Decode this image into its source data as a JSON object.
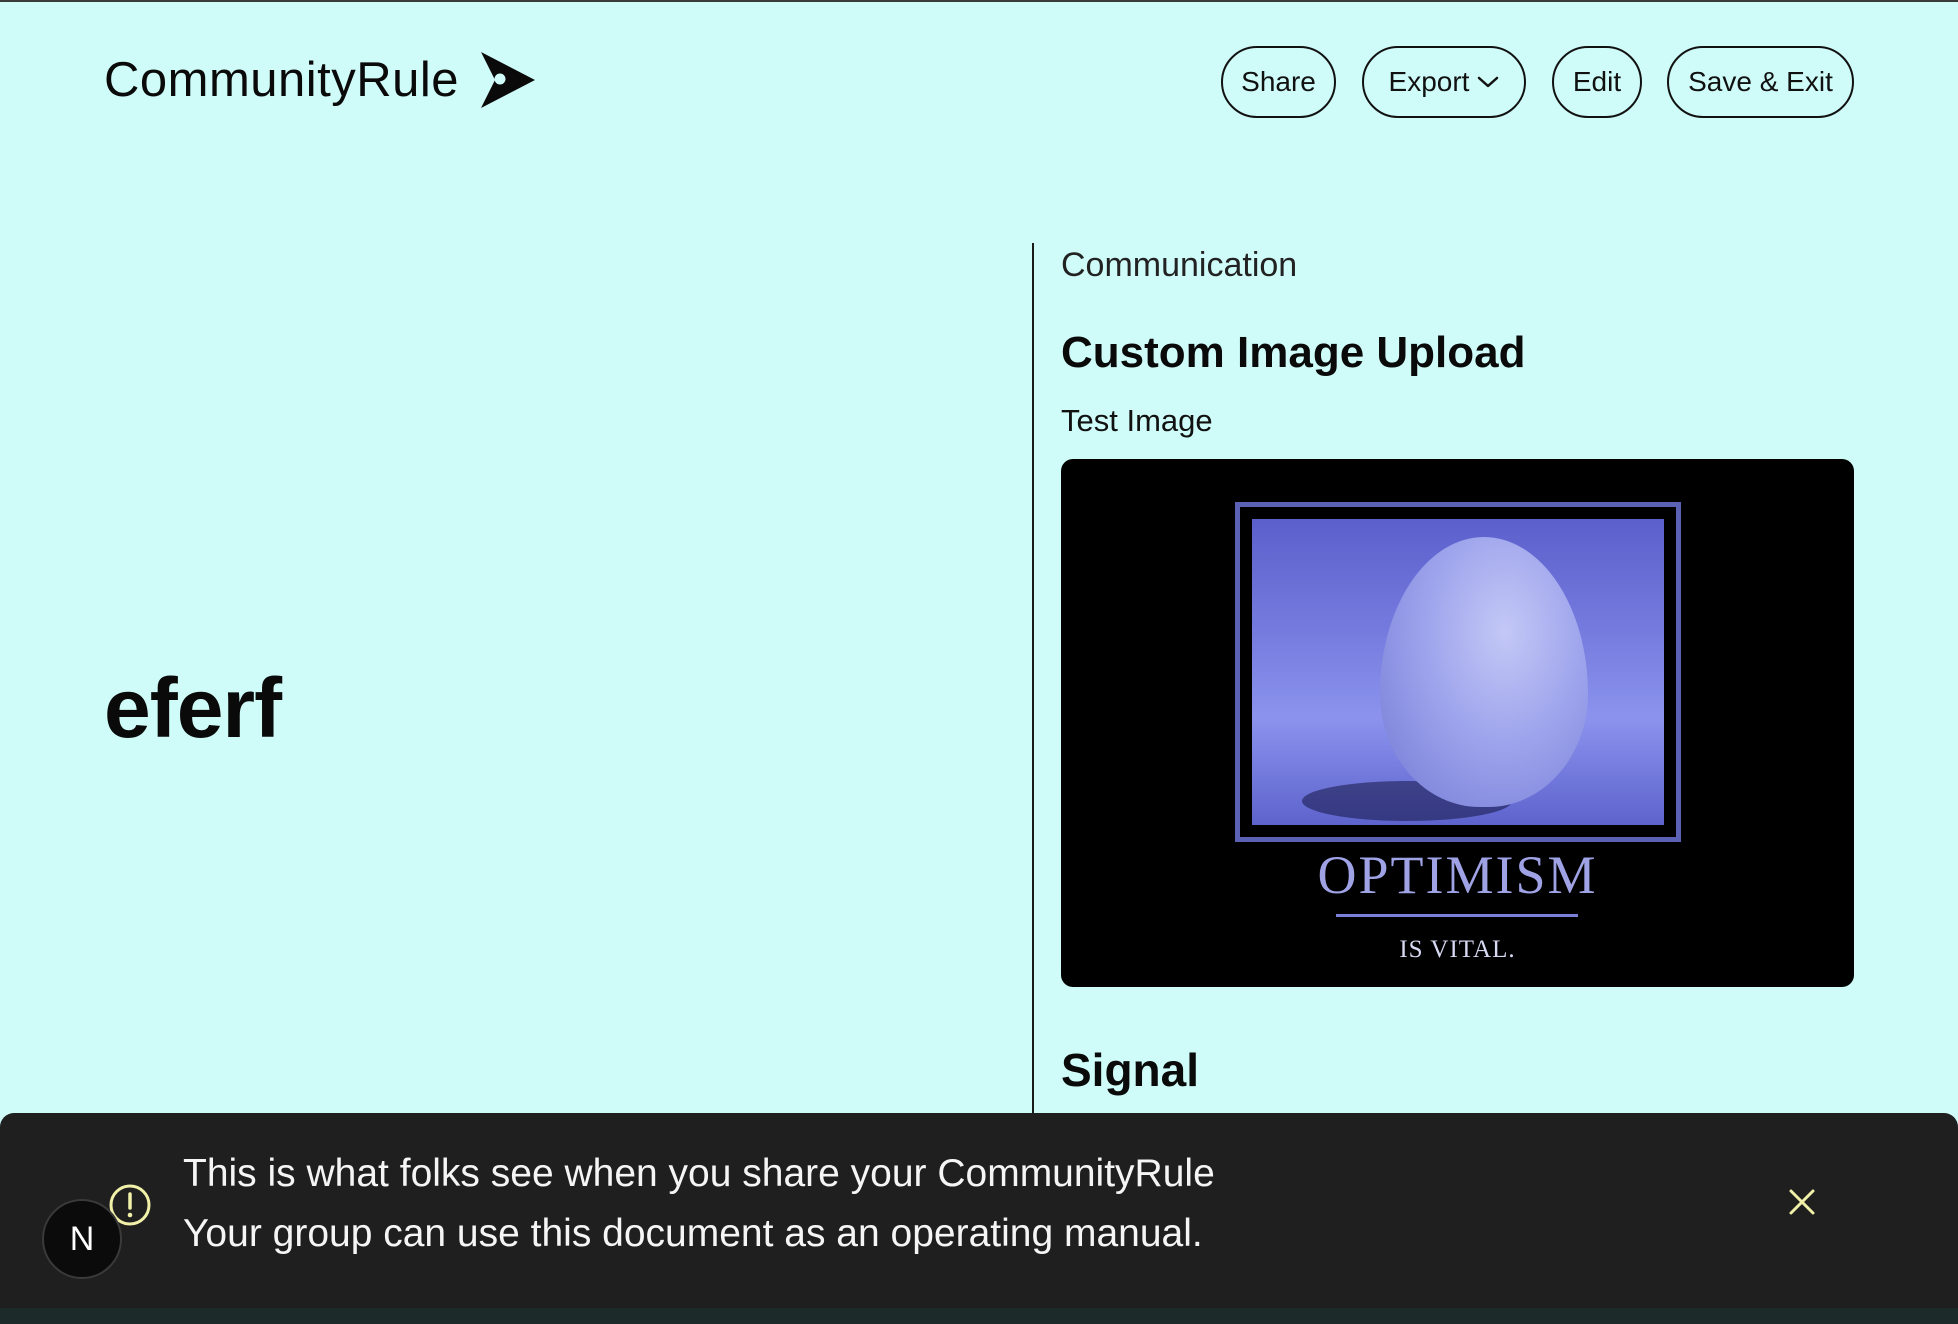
{
  "header": {
    "logo_text": "CommunityRule",
    "logo_icon": "arrow-play-icon",
    "buttons": {
      "share": "Share",
      "export": "Export",
      "edit": "Edit",
      "save_exit": "Save & Exit"
    }
  },
  "rule": {
    "title": "eferf"
  },
  "content": {
    "section_label": "Communication",
    "module_title": "Custom Image Upload",
    "image_label": "Test Image",
    "image": {
      "main_text": "OPTIMISM",
      "sub_text": "IS VITAL."
    },
    "next_module_title": "Signal"
  },
  "toast": {
    "icon": "warning-icon",
    "line1": "This is what folks see when you share your CommunityRule",
    "line2": "Your group can use this document as an operating manual.",
    "close_icon": "close-icon"
  },
  "avatar": {
    "initial": "N"
  },
  "colors": {
    "background": "#cffcf9",
    "toast_bg": "#1f1f1f",
    "warning_accent": "#f0f0a8",
    "poster_accent": "#5b62b6"
  }
}
